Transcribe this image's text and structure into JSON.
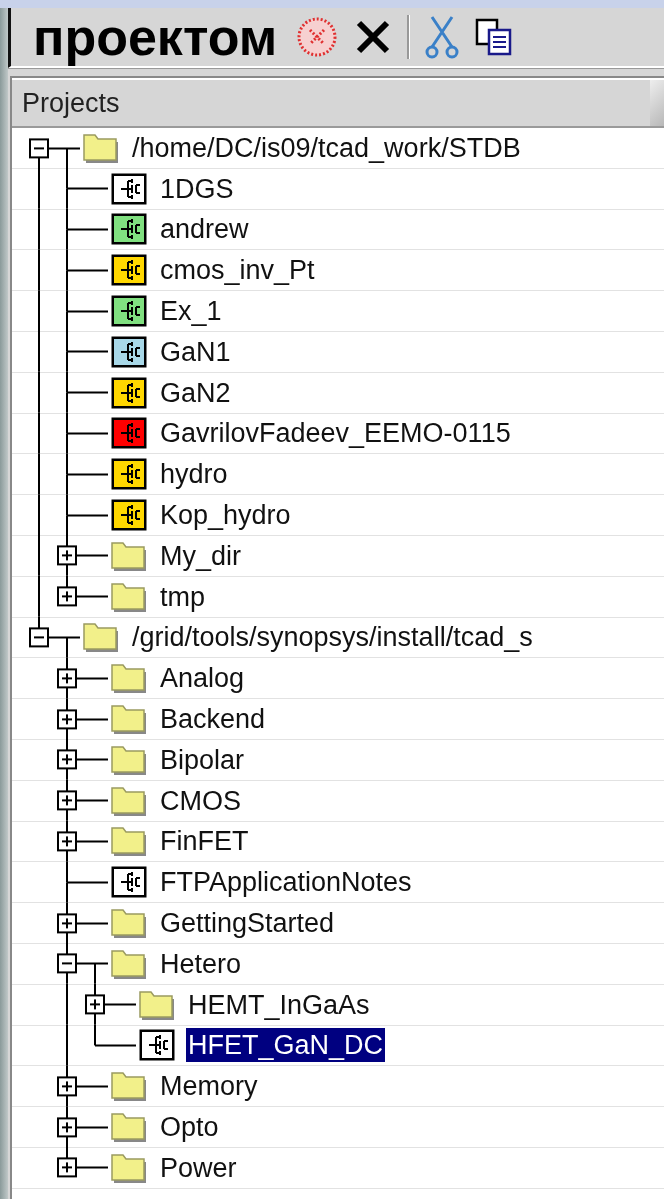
{
  "overlay_caption": "проектом",
  "tree": {
    "header": "Projects",
    "items": [
      {
        "kind": "folder",
        "label": "/home/DC/is09/tcad_work/STDB",
        "expanded": true,
        "selected": false,
        "children": [
          {
            "kind": "project",
            "label": "1DGS",
            "color": "#ffffff",
            "selected": false
          },
          {
            "kind": "project",
            "label": "andrew",
            "color": "#80e080",
            "selected": false
          },
          {
            "kind": "project",
            "label": "cmos_inv_Pt",
            "color": "#ffd700",
            "selected": false
          },
          {
            "kind": "project",
            "label": "Ex_1",
            "color": "#80e080",
            "selected": false
          },
          {
            "kind": "project",
            "label": "GaN1",
            "color": "#a8d8e8",
            "selected": false
          },
          {
            "kind": "project",
            "label": "GaN2",
            "color": "#ffd700",
            "selected": false
          },
          {
            "kind": "project",
            "label": "GavrilovFadeev_EEMO-0115",
            "color": "#ff0000",
            "selected": false
          },
          {
            "kind": "project",
            "label": "hydro",
            "color": "#ffd700",
            "selected": false
          },
          {
            "kind": "project",
            "label": "Kop_hydro",
            "color": "#ffd700",
            "selected": false
          },
          {
            "kind": "folder",
            "label": "My_dir",
            "expanded": false,
            "selected": false
          },
          {
            "kind": "folder",
            "label": "tmp",
            "expanded": false,
            "selected": false
          }
        ]
      },
      {
        "kind": "folder",
        "label": "/grid/tools/synopsys/install/tcad_s",
        "expanded": true,
        "selected": false,
        "children": [
          {
            "kind": "folder",
            "label": "Analog",
            "expanded": false,
            "selected": false
          },
          {
            "kind": "folder",
            "label": "Backend",
            "expanded": false,
            "selected": false
          },
          {
            "kind": "folder",
            "label": "Bipolar",
            "expanded": false,
            "selected": false
          },
          {
            "kind": "folder",
            "label": "CMOS",
            "expanded": false,
            "selected": false
          },
          {
            "kind": "folder",
            "label": "FinFET",
            "expanded": false,
            "selected": false
          },
          {
            "kind": "project",
            "label": "FTPApplicationNotes",
            "color": "#ffffff",
            "selected": false
          },
          {
            "kind": "folder",
            "label": "GettingStarted",
            "expanded": false,
            "selected": false
          },
          {
            "kind": "folder",
            "label": "Hetero",
            "expanded": true,
            "selected": false,
            "children": [
              {
                "kind": "folder",
                "label": "HEMT_InGaAs",
                "expanded": false,
                "selected": false
              },
              {
                "kind": "project",
                "label": "HFET_GaN_DC",
                "color": "#ffffff",
                "selected": true
              }
            ]
          },
          {
            "kind": "folder",
            "label": "Memory",
            "expanded": false,
            "selected": false
          },
          {
            "kind": "folder",
            "label": "Opto",
            "expanded": false,
            "selected": false
          },
          {
            "kind": "folder",
            "label": "Power",
            "expanded": false,
            "selected": false
          }
        ]
      }
    ]
  }
}
